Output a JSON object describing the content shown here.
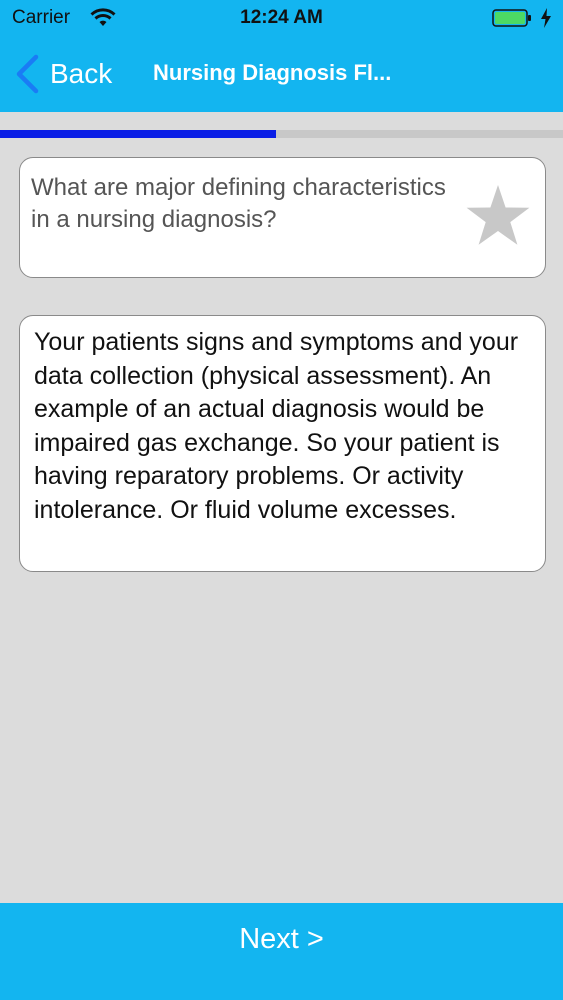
{
  "status_bar": {
    "carrier": "Carrier",
    "time": "12:24 AM"
  },
  "nav": {
    "back_label": "Back",
    "title": "Nursing Diagnosis Fl..."
  },
  "progress": {
    "fraction": 0.49
  },
  "question": {
    "text": "What are major defining characteristics in a nursing diagnosis?",
    "favorite_icon": "star-icon"
  },
  "answer": {
    "text": "Your patients signs and symptoms and your data collection (physical assessment). An example of an actual diagnosis would be impaired gas exchange. So your patient is having reparatory problems. Or activity intolerance. Or fluid volume excesses."
  },
  "footer": {
    "next_label": "Next >"
  },
  "colors": {
    "header_bg": "#13b5f0",
    "progress_fill": "#0a1ee6",
    "back_chevron": "#1a7cf5",
    "star": "#c8c8c8",
    "battery": "#4cd964"
  }
}
